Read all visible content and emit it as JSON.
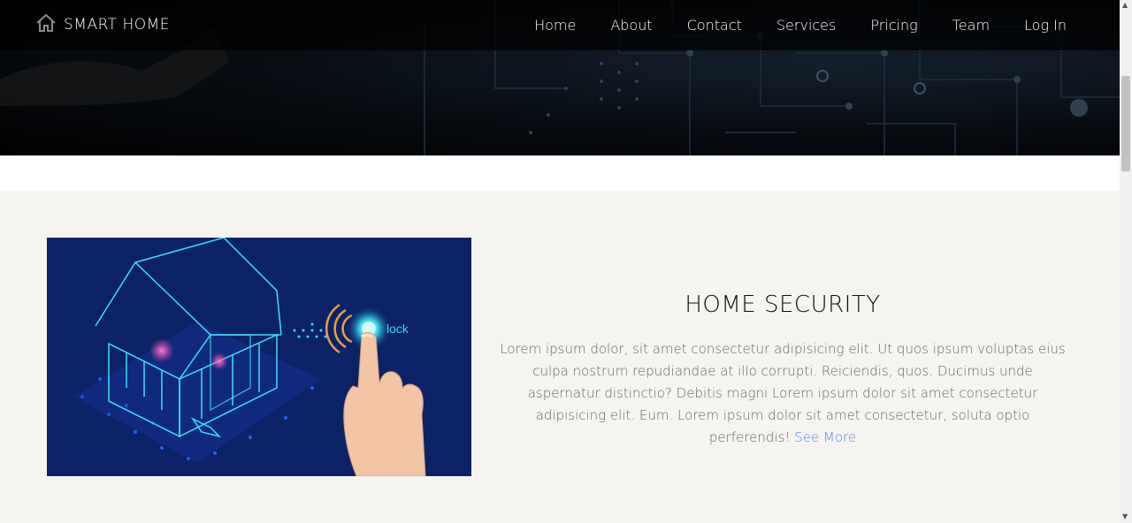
{
  "brand": {
    "name": "SMART HOME",
    "icon": "home-icon"
  },
  "nav": {
    "items": [
      "Home",
      "About",
      "Contact",
      "Services",
      "Pricing",
      "Team",
      "Log In"
    ]
  },
  "feature": {
    "title": "HOME SECURITY",
    "body": "Lorem ipsum dolor, sit amet consectetur adipisicing elit. Ut quos ipsum voluptas eius culpa nostrum repudiandae at illo corrupti. Reiciendis, quos. Ducimus unde aspernatur distinctio? Debitis magni Lorem ipsum dolor sit amet consectetur adipisicing elit. Eum. Lorem ipsum dolor sit amet consectetur, soluta optio perferendis!",
    "link": "See More",
    "image_label": "lock"
  },
  "colors": {
    "nav_bg": "#000000",
    "section_bg": "#f5f4f1",
    "link": "#4f86e8",
    "image_bg": "#0b2266",
    "glow": "#35d6f0"
  }
}
